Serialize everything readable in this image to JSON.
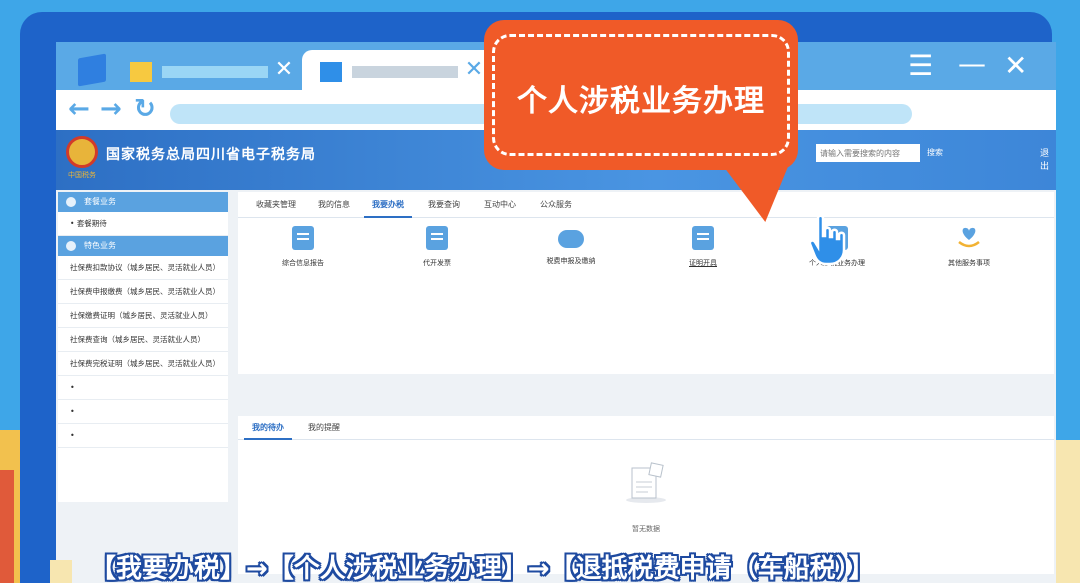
{
  "callout": {
    "text": "个人涉税业务办理"
  },
  "site": {
    "title": "国家税务总局四川省电子税务局",
    "emblem_text": "中国税务",
    "search_placeholder": "请输入需要搜索的内容",
    "search_button": "搜索",
    "logout": "退出"
  },
  "sidebar": {
    "groups": [
      {
        "label": "套餐业务",
        "items": [
          "套餐期待"
        ]
      },
      {
        "label": "特色业务",
        "items": [
          "社保费扣款协议（城乡居民、灵活就业人员）",
          "社保费申报缴费（城乡居民、灵活就业人员）",
          "社保缴费证明（城乡居民、灵活就业人员）",
          "社保费查询（城乡居民、灵活就业人员）",
          "社保费完税证明（城乡居民、灵活就业人员）"
        ]
      }
    ]
  },
  "nav_tabs": [
    "收藏夹管理",
    "我的信息",
    "我要办税",
    "我要查询",
    "互动中心",
    "公众服务"
  ],
  "active_nav_tab": "我要办税",
  "services": [
    {
      "label": "综合信息报告",
      "icon": "document-icon"
    },
    {
      "label": "代开发票",
      "icon": "invoice-icon"
    },
    {
      "label": "税费申报及缴纳",
      "icon": "cloud-pay-icon"
    },
    {
      "label": "证明开具",
      "icon": "certificate-icon"
    },
    {
      "label": "个人涉税业务办理",
      "icon": "personal-tax-icon"
    },
    {
      "label": "其他服务事项",
      "icon": "heart-hand-icon"
    }
  ],
  "todo": {
    "tabs": [
      "我的待办",
      "我的提醒"
    ],
    "active_tab": "我的待办",
    "empty_text": "暂无数据"
  },
  "caption": "【我要办税】→【个人涉税业务办理】→【退抵税费申请（车船税）】",
  "colors": {
    "accent": "#2d6fc4",
    "callout": "#f05a28",
    "frame": "#1e63c9"
  }
}
